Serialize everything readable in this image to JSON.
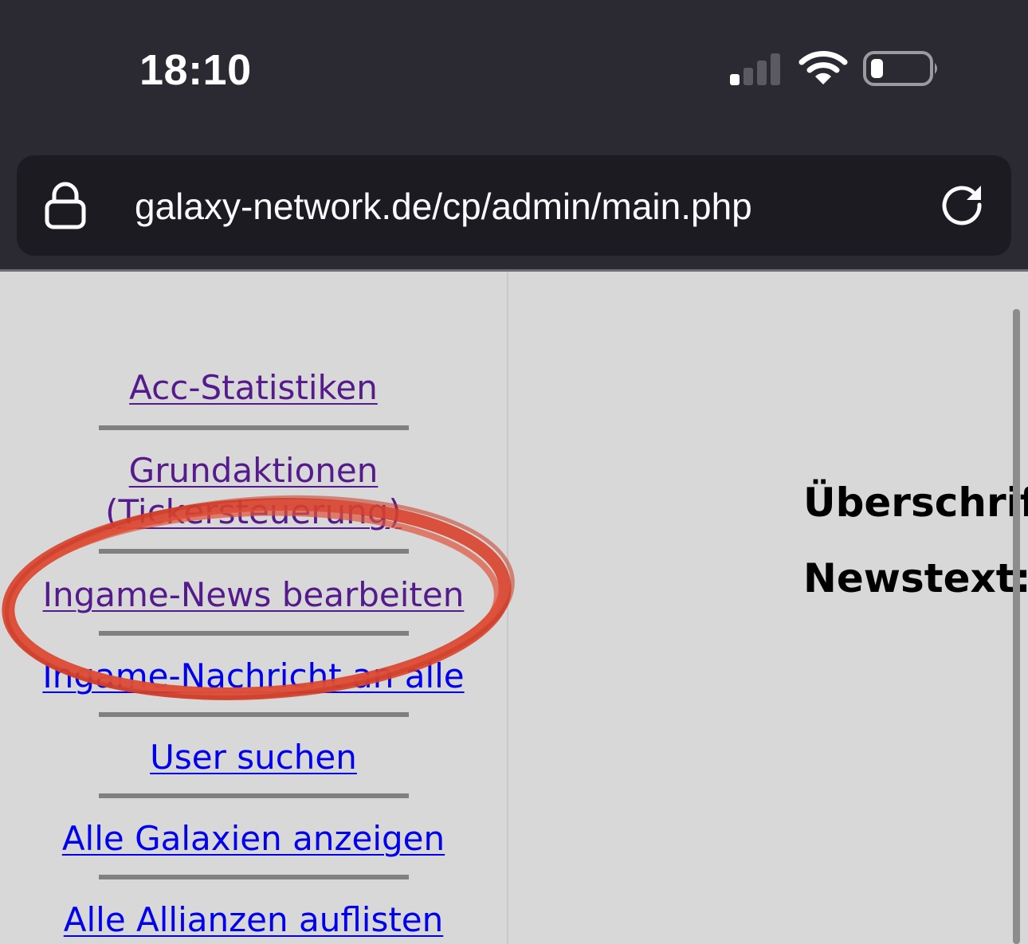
{
  "status_bar": {
    "time": "18:10"
  },
  "browser": {
    "url": "galaxy-network.de/cp/admin/main.php"
  },
  "nav": {
    "items": [
      {
        "label": "Acc-Statistiken",
        "visited": true
      },
      {
        "label": "Grundaktionen",
        "visited": true
      },
      {
        "label": "(Tickersteuerung)",
        "visited": true
      },
      {
        "label": "Ingame-News bearbeiten",
        "visited": true
      },
      {
        "label": "Ingame-Nachricht an alle",
        "visited": false
      },
      {
        "label": "User suchen",
        "visited": false
      },
      {
        "label": "Alle Galaxien anzeigen",
        "visited": false
      },
      {
        "label": "Alle Allianzen auflisten",
        "visited": false
      }
    ]
  },
  "main": {
    "heading_label": "Überschrift:",
    "newstext_label": "Newstext:"
  },
  "colors": {
    "chrome_bg": "#2b2a33",
    "address_bar_bg": "#1c1b22",
    "page_bg": "#d8d8d8",
    "link": "#0000ee",
    "visited_link": "#551a8b",
    "annotation_red": "#d9412b"
  },
  "icons": {
    "lock": "lock-icon",
    "reload": "reload-icon",
    "signal": "cellular-signal-icon",
    "wifi": "wifi-icon",
    "battery": "battery-icon"
  }
}
